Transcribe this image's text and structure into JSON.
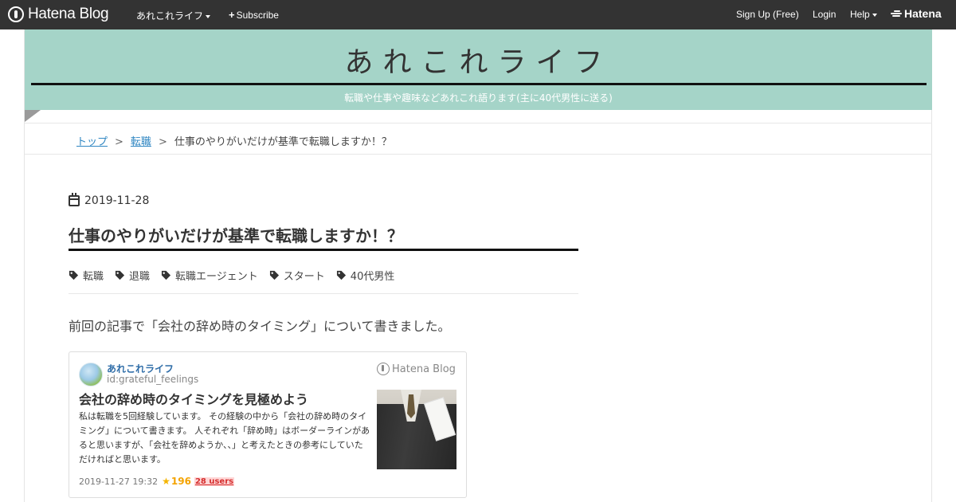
{
  "topbar": {
    "logo_text": "Hatena Blog",
    "blog_menu_label": "あれこれライフ",
    "subscribe_label": "Subscribe",
    "signup_label": "Sign Up (Free)",
    "login_label": "Login",
    "help_label": "Help",
    "hatena_brand": "Hatena",
    "bar_color": "#333333"
  },
  "header": {
    "title": "あれこれライフ",
    "description": "転職や仕事や趣味などあれこれ語ります(主に40代男性に送る)",
    "background_color": "#a5d4c8"
  },
  "breadcrumb": {
    "items": [
      {
        "label": "トップ",
        "link": true
      },
      {
        "label": "転職",
        "link": true
      },
      {
        "label": "仕事のやりがいだけが基準で転職しますか！？",
        "link": false
      }
    ],
    "separator": ">"
  },
  "article": {
    "date": "2019-11-28",
    "title": "仕事のやりがいだけが基準で転職しますか！？",
    "tags": [
      "転職",
      "退職",
      "転職エージェント",
      "スタート",
      "40代男性"
    ],
    "intro": "前回の記事で「会社の辞め時のタイミング」について書きました。"
  },
  "embed_card": {
    "blog_name": "あれこれライフ",
    "user_id": "id:grateful_feelings",
    "brand": "Hatena Blog",
    "title": "会社の辞め時のタイミングを見極めよう",
    "summary": "私は転職を5回経験しています。 その経験の中から「会社の辞め時のタイミング」について書きます。 人それぞれ「辞め時」はボーダーラインがあると思いますが、「会社を辞めようか、、」と考えたときの参考にしていただければと思います。",
    "date": "2019-11-27 19:32",
    "star_icon": "★",
    "star_count": "196",
    "users": "28 users"
  }
}
